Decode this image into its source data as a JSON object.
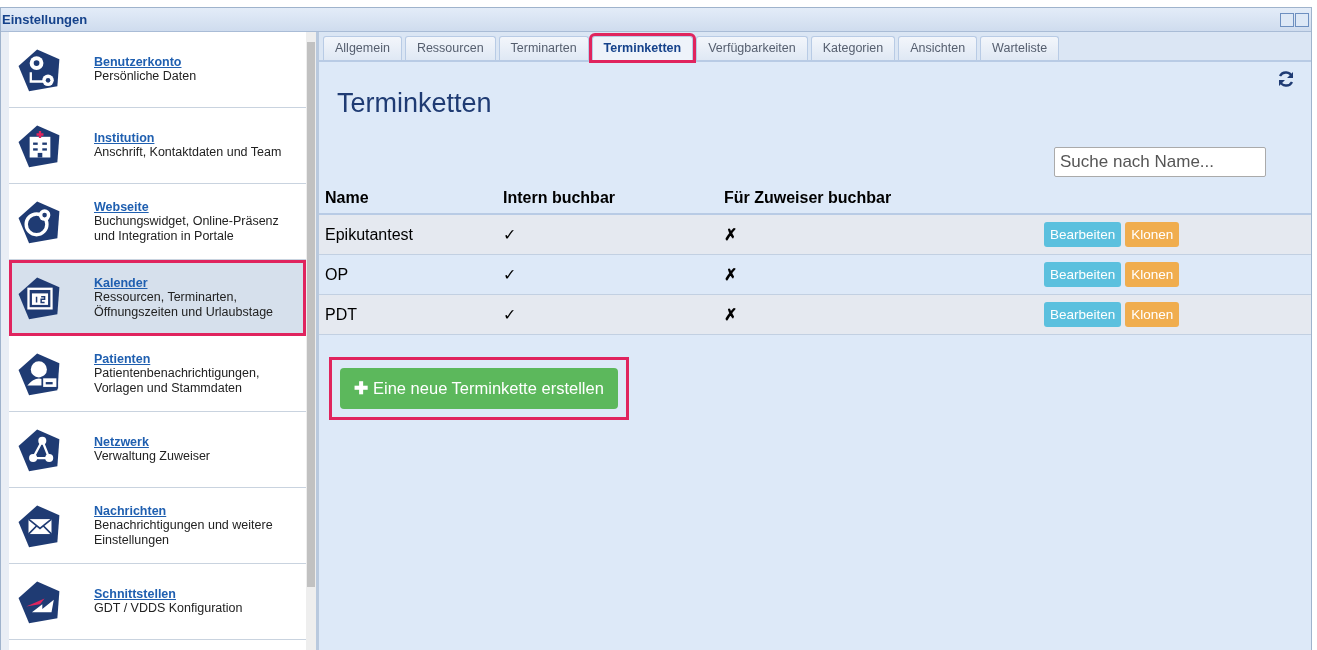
{
  "window": {
    "title": "Einstellungen"
  },
  "sidebar": {
    "items": [
      {
        "title": "Benutzerkonto",
        "subtitle": "Persönliche Daten",
        "selected": false,
        "highlighted": false
      },
      {
        "title": "Institution",
        "subtitle": "Anschrift, Kontaktdaten und Team",
        "selected": false,
        "highlighted": false
      },
      {
        "title": "Webseite",
        "subtitle": "Buchungswidget, Online-Präsenz und Integration in Portale",
        "selected": false,
        "highlighted": false
      },
      {
        "title": "Kalender",
        "subtitle": "Ressourcen, Terminarten, Öffnungszeiten und Urlaubstage",
        "selected": true,
        "highlighted": true
      },
      {
        "title": "Patienten",
        "subtitle": "Patientenbenachrichtigungen, Vorlagen und Stammdaten",
        "selected": false,
        "highlighted": false
      },
      {
        "title": "Netzwerk",
        "subtitle": "Verwaltung Zuweiser",
        "selected": false,
        "highlighted": false
      },
      {
        "title": "Nachrichten",
        "subtitle": "Benachrichtigungen und weitere Einstellungen",
        "selected": false,
        "highlighted": false
      },
      {
        "title": "Schnittstellen",
        "subtitle": "GDT / VDDS Konfiguration",
        "selected": false,
        "highlighted": false
      }
    ]
  },
  "tabs": [
    {
      "label": "Allgemein",
      "selected": false,
      "highlighted": false
    },
    {
      "label": "Ressourcen",
      "selected": false,
      "highlighted": false
    },
    {
      "label": "Terminarten",
      "selected": false,
      "highlighted": false
    },
    {
      "label": "Terminketten",
      "selected": true,
      "highlighted": true
    },
    {
      "label": "Verfügbarkeiten",
      "selected": false,
      "highlighted": false
    },
    {
      "label": "Kategorien",
      "selected": false,
      "highlighted": false
    },
    {
      "label": "Ansichten",
      "selected": false,
      "highlighted": false
    },
    {
      "label": "Warteliste",
      "selected": false,
      "highlighted": false
    }
  ],
  "heading": "Terminketten",
  "search": {
    "placeholder": "Suche nach Name..."
  },
  "table": {
    "columns": [
      "Name",
      "Intern buchbar",
      "Für Zuweiser buchbar"
    ],
    "rows": [
      {
        "name": "Epikutantest",
        "intern": "✓",
        "zuweiser": "✗",
        "edit": "Bearbeiten",
        "clone": "Klonen"
      },
      {
        "name": "OP",
        "intern": "✓",
        "zuweiser": "✗",
        "edit": "Bearbeiten",
        "clone": "Klonen"
      },
      {
        "name": "PDT",
        "intern": "✓",
        "zuweiser": "✗",
        "edit": "Bearbeiten",
        "clone": "Klonen"
      }
    ]
  },
  "create_button": {
    "icon": "✚",
    "label": "Eine neue Terminkette erstellen",
    "highlighted": true
  }
}
